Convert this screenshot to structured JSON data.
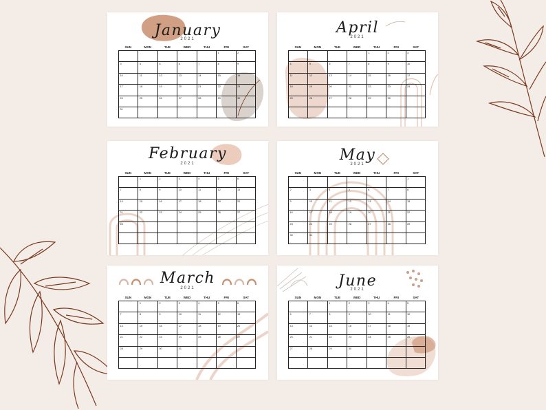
{
  "weekdays": [
    "SUN",
    "MON",
    "TUE",
    "WED",
    "THU",
    "FRI",
    "SAT"
  ],
  "calendars": [
    {
      "month": "January",
      "year": "2021",
      "start": 5,
      "days": 31
    },
    {
      "month": "April",
      "year": "2021",
      "start": 4,
      "days": 30
    },
    {
      "month": "February",
      "year": "2021",
      "start": 1,
      "days": 28
    },
    {
      "month": "May",
      "year": "2021",
      "start": 6,
      "days": 31
    },
    {
      "month": "March",
      "year": "2021",
      "start": 1,
      "days": 31
    },
    {
      "month": "June",
      "year": "2021",
      "start": 2,
      "days": 30
    }
  ],
  "colors": {
    "background": "#f3ece7",
    "accent": "#c98f6f",
    "blush": "#ecd4c8",
    "branch": "#7a3a20"
  }
}
